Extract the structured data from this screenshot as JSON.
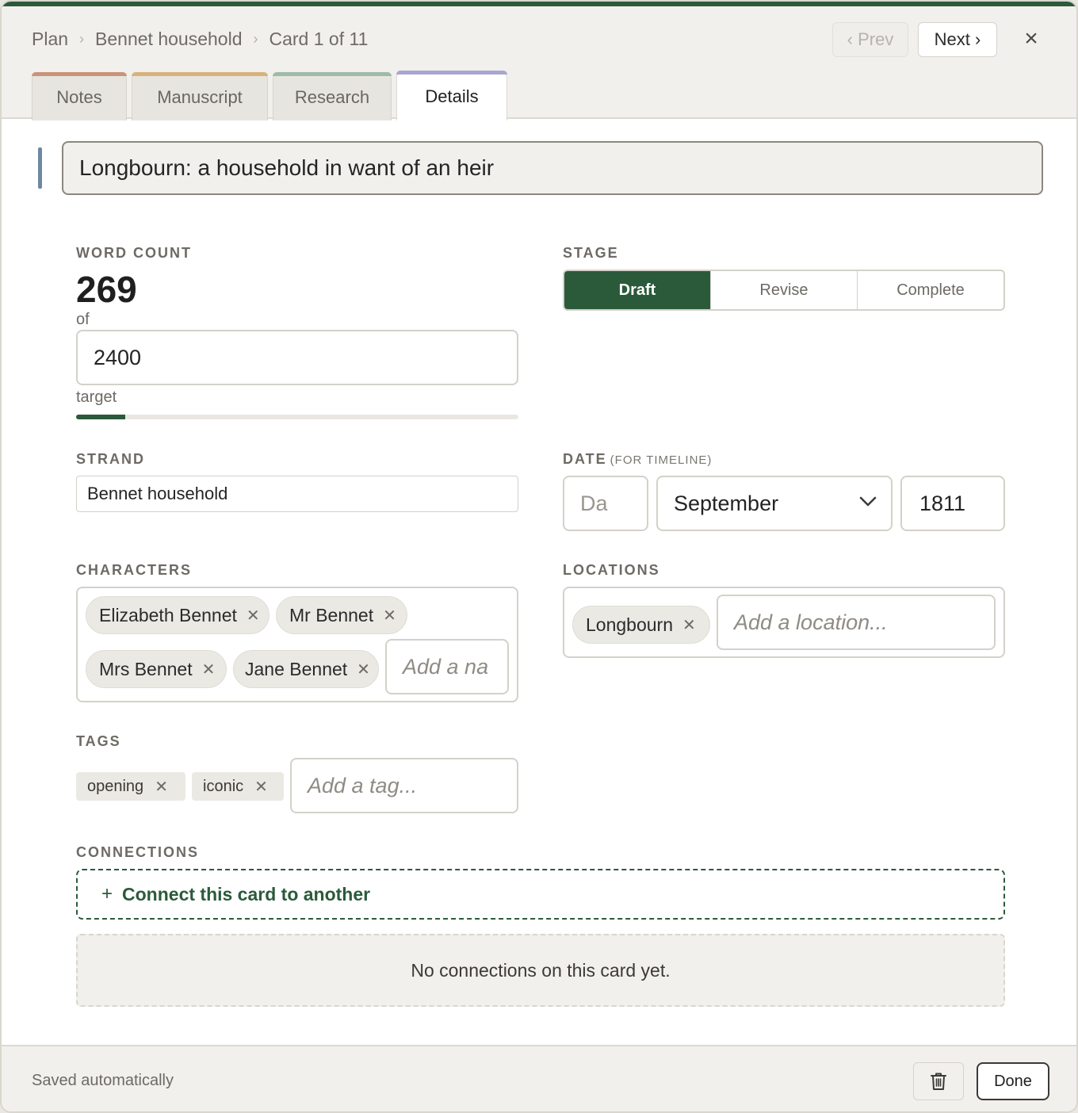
{
  "breadcrumb": {
    "root": "Plan",
    "strand": "Bennet household",
    "card": "Card 1 of 11"
  },
  "nav": {
    "prev": "‹ Prev",
    "next": "Next ›",
    "close": "×"
  },
  "tabs": [
    {
      "label": "Notes",
      "color": "#c9937a"
    },
    {
      "label": "Manuscript",
      "color": "#d8b27c"
    },
    {
      "label": "Research",
      "color": "#9dbba8"
    },
    {
      "label": "Details",
      "color": "#a9a6d1",
      "active": true
    }
  ],
  "title": "Longbourn: a household in want of an heir",
  "word_count": {
    "label": "Word count",
    "value": "269",
    "of_text": "of",
    "target": "2400",
    "target_label": "target",
    "progress_fraction": 0.112
  },
  "stage": {
    "label": "Stage",
    "options": [
      "Draft",
      "Revise",
      "Complete"
    ],
    "selected": "Draft"
  },
  "strand": {
    "label": "Strand",
    "value": "Bennet household"
  },
  "date": {
    "label": "Date",
    "sublabel": "(for timeline)",
    "day_placeholder": "Da",
    "month": "September",
    "year": "1811"
  },
  "characters": {
    "label": "Characters",
    "chips": [
      "Elizabeth Bennet",
      "Mr Bennet",
      "Mrs Bennet",
      "Jane Bennet"
    ],
    "placeholder": "Add a na"
  },
  "locations": {
    "label": "Locations",
    "chips": [
      "Longbourn"
    ],
    "placeholder": "Add a location..."
  },
  "tags": {
    "label": "Tags",
    "chips": [
      "opening",
      "iconic"
    ],
    "placeholder": "Add a tag..."
  },
  "connections": {
    "label": "Connections",
    "add": "Connect this card to another",
    "empty": "No connections on this card yet."
  },
  "footer": {
    "saved": "Saved automatically",
    "done": "Done"
  },
  "colors": {
    "accent": "#2b5a3b",
    "title_bar": "#6d88a0"
  }
}
